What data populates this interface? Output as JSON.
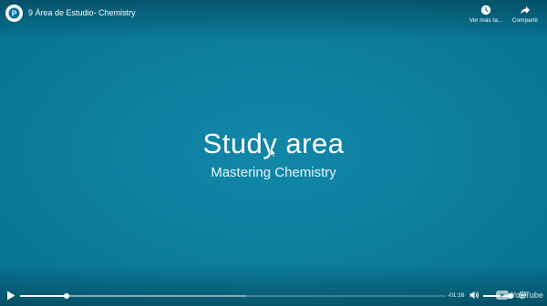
{
  "header": {
    "title": "9 Área de Estudio- Chemistry",
    "channel_logo_icon": "pearson-logo-icon",
    "actions": [
      {
        "label": "Ver más ta...",
        "icon": "clock-icon"
      },
      {
        "label": "Compartir",
        "icon": "share-arrow-icon"
      }
    ]
  },
  "video": {
    "title_text": "Study area",
    "subtitle_text": "Mastering Chemistry",
    "background_color": "#0b7c9c"
  },
  "controls": {
    "time_remaining": "-01:16",
    "progress_played_fraction": 0.11,
    "progress_buffered_fraction": 0.53,
    "volume_fraction": 0.95,
    "brand": "YouTube"
  }
}
